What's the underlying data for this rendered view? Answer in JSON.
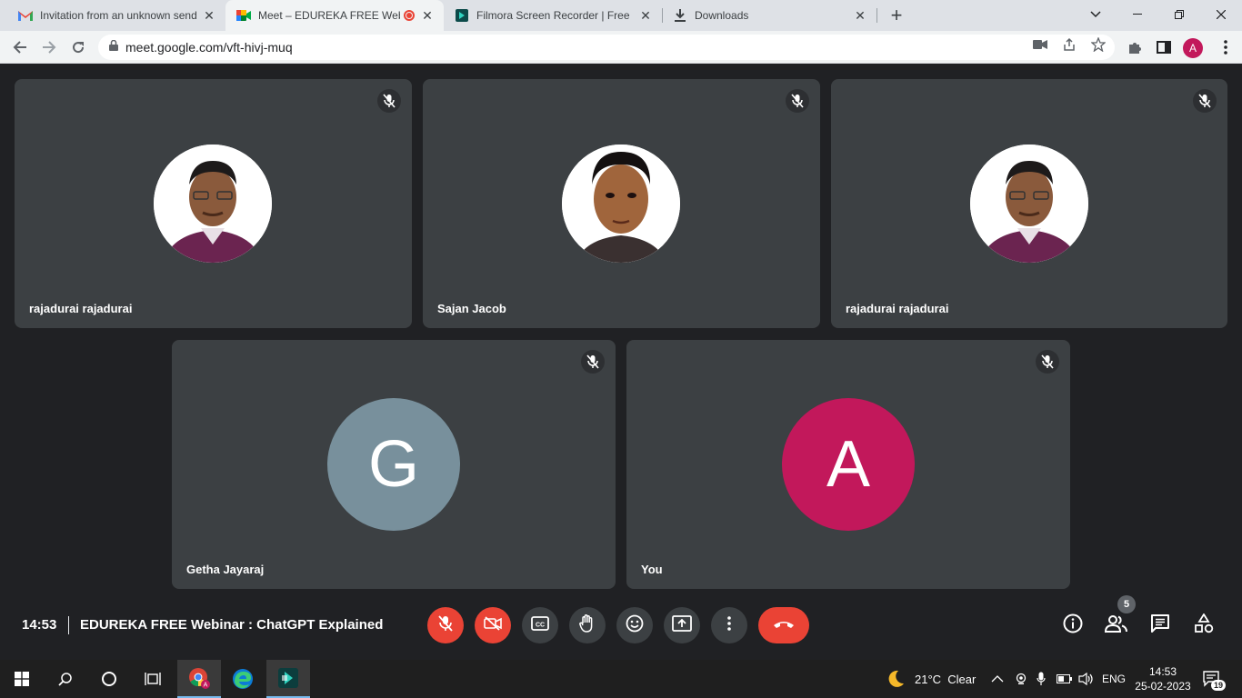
{
  "browser": {
    "tabs": [
      {
        "title": "Invitation from an unknown send",
        "icon": "gmail-icon"
      },
      {
        "title": "Meet – EDUREKA FREE Webi",
        "icon": "meet-icon",
        "recording": true
      },
      {
        "title": "Filmora Screen Recorder | Free D",
        "icon": "filmora-icon"
      },
      {
        "title": "Downloads",
        "icon": "download-icon"
      }
    ],
    "new_tab": "+",
    "url": "meet.google.com/vft-hivj-muq",
    "profile_initial": "A"
  },
  "participants": [
    {
      "name": "rajadurai rajadurai",
      "type": "photo",
      "muted": true
    },
    {
      "name": "Sajan Jacob",
      "type": "photo",
      "muted": true
    },
    {
      "name": "rajadurai rajadurai",
      "type": "photo",
      "muted": true
    },
    {
      "name": "Getha Jayaraj",
      "type": "letter",
      "letter": "G",
      "color": "#78909c",
      "muted": true
    },
    {
      "name": "You",
      "type": "letter",
      "letter": "A",
      "color": "#c2185b",
      "muted": true
    }
  ],
  "meeting": {
    "time": "14:53",
    "title": "EDUREKA FREE Webinar : ChatGPT Explained",
    "participant_count": "5"
  },
  "controls": [
    "mic-off-icon",
    "camera-off-icon",
    "captions-icon",
    "raise-hand-icon",
    "emoji-icon",
    "present-screen-icon",
    "more-options-icon",
    "end-call-icon"
  ],
  "taskbar": {
    "weather": "21°C  Clear",
    "language": "ENG",
    "clock_time": "14:53",
    "clock_date": "25-02-2023",
    "notifications": "19"
  },
  "colors": {
    "meet_bg": "#202124",
    "tile_bg": "#3c4043",
    "danger": "#ea4335"
  }
}
